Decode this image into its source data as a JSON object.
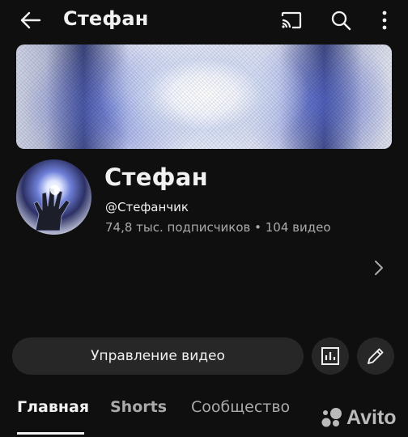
{
  "header": {
    "title": "Стефан",
    "icons": [
      "back-arrow-icon",
      "cast-icon",
      "search-icon",
      "more-vert-icon"
    ]
  },
  "channel": {
    "name": "Стефан",
    "handle": "@Стефанчик",
    "stats": "74,8 тыс. подписчиков • 104 видео"
  },
  "actions": {
    "manage_label": "Управление видео",
    "icons": [
      "analytics-icon",
      "edit-pencil-icon"
    ]
  },
  "tabs": [
    {
      "label": "Главная",
      "active": true
    },
    {
      "label": "Shorts",
      "active": false
    },
    {
      "label": "Сообщество",
      "active": false
    }
  ],
  "watermark": {
    "text": "Avito"
  },
  "colors": {
    "background": "#0f0f0f",
    "surface": "#272727",
    "text_primary": "#f1f1f1",
    "text_secondary": "#aaaaaa"
  }
}
